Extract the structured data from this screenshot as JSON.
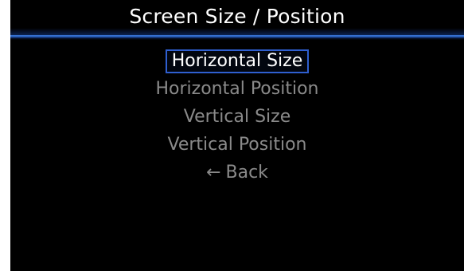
{
  "header": {
    "title": "Screen Size / Position"
  },
  "menu": {
    "items": [
      {
        "label": "Horizontal Size",
        "selected": true
      },
      {
        "label": "Horizontal Position",
        "selected": false
      },
      {
        "label": "Vertical Size",
        "selected": false
      },
      {
        "label": "Vertical Position",
        "selected": false
      }
    ],
    "back": {
      "icon": "left-arrow-icon",
      "icon_glyph": "←",
      "label": "Back"
    }
  },
  "colors": {
    "background": "#000000",
    "title_text": "#ffffff",
    "accent": "#2f5fd0",
    "inactive_text": "#8a8a8a"
  }
}
